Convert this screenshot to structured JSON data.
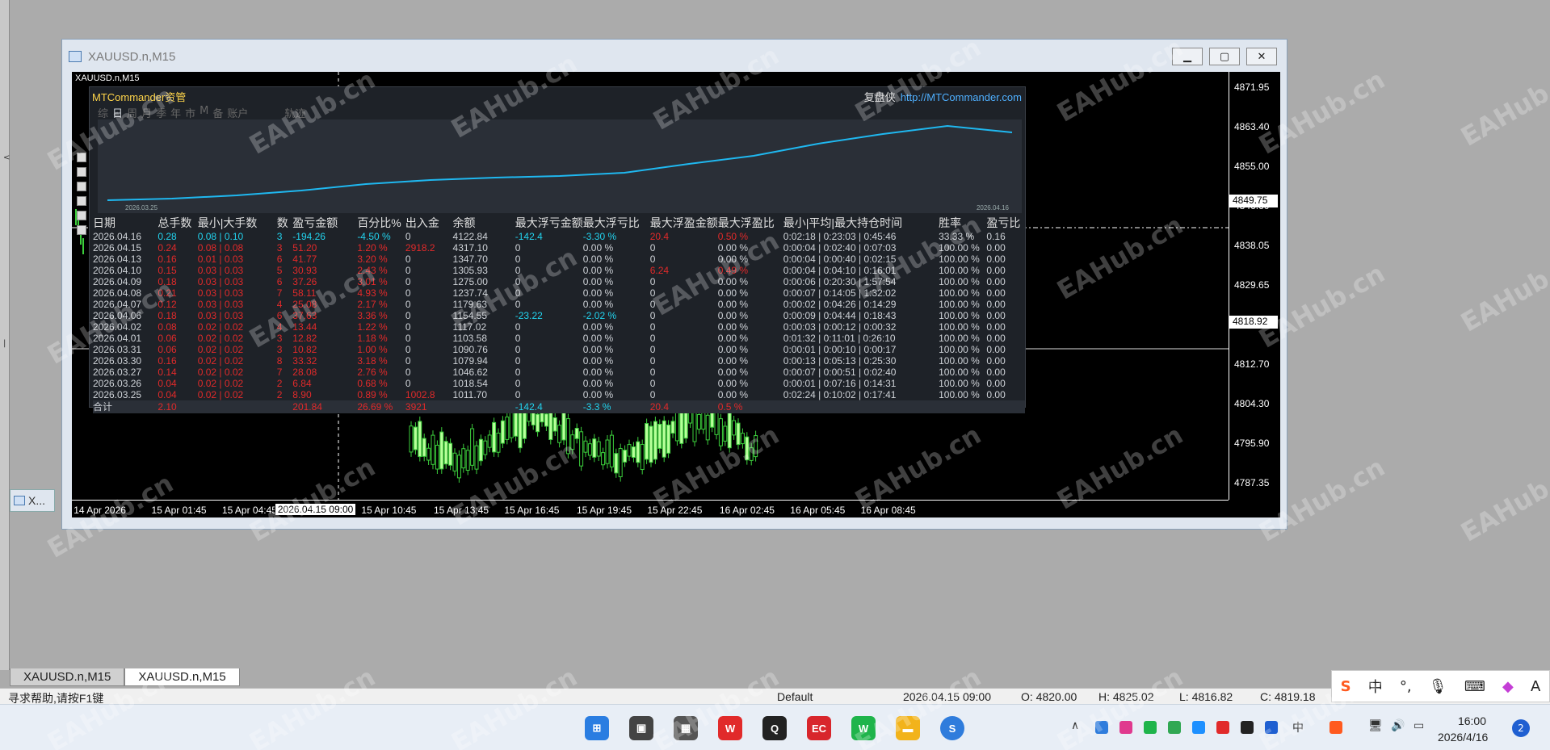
{
  "window": {
    "title": "XAUUSD.n,M15",
    "minimized_label": "X..."
  },
  "chart": {
    "symbol_label": "XAUUSD.n,M15",
    "price_labels": [
      "4871.95",
      "4863.40",
      "4855.00",
      "4846.60",
      "4838.05",
      "4829.65",
      "4821.25",
      "4812.70",
      "4804.30",
      "4795.90",
      "4787.35"
    ],
    "price_tag_1": "4849.75",
    "price_tag_2": "4818.92",
    "time_labels": [
      "14 Apr 2026",
      "15 Apr 01:45",
      "15 Apr 04:45",
      "2026.04.15 09:00",
      "15 Apr 10:45",
      "15 Apr 13:45",
      "15 Apr 16:45",
      "15 Apr 19:45",
      "15 Apr 22:45",
      "16 Apr 02:45",
      "16 Apr 05:45",
      "16 Apr 08:45"
    ],
    "highlighted_time": "2026.04.15 09:00",
    "grid": false
  },
  "overlay": {
    "title": "MTCommander资管",
    "link_prefix": "复盘侠",
    "link": "http://MTCommander.com",
    "tabs": [
      "综",
      "日",
      "周",
      "月",
      "季",
      "年",
      "市",
      "M",
      "备",
      "账户"
    ],
    "active_tab": "日",
    "track_label": "轨迹",
    "equity_start_date": "2026.03.25",
    "equity_end_date": "2026.04.16",
    "headers": [
      "日期",
      "总手数",
      "最小|大手数",
      "数",
      "盈亏金额",
      "百分比%",
      "出入金",
      "余额",
      "最大浮亏金额",
      "最大浮亏比",
      "最大浮盈金额",
      "最大浮盈比",
      "最小|平均|最大持仓时间",
      "胜率",
      "盈亏比"
    ],
    "rows": [
      [
        "2026.04.16",
        "0.28",
        "0.08 | 0.10",
        "3",
        "-194.26",
        "-4.50 %",
        "0",
        "4122.84",
        "-142.4",
        "-3.30 %",
        "20.4",
        "0.50 %",
        "0:02:18 | 0:23:03 | 0:45:46",
        "33.33 %",
        "0.16"
      ],
      [
        "2026.04.15",
        "0.24",
        "0.08 | 0.08",
        "3",
        "51.20",
        "1.20 %",
        "2918.2",
        "4317.10",
        "0",
        "0.00 %",
        "0",
        "0.00 %",
        "0:00:04 | 0:02:40 | 0:07:03",
        "100.00 %",
        "0.00"
      ],
      [
        "2026.04.13",
        "0.16",
        "0.01 | 0.03",
        "6",
        "41.77",
        "3.20 %",
        "0",
        "1347.70",
        "0",
        "0.00 %",
        "0",
        "0.00 %",
        "0:00:04 | 0:00:40 | 0:02:15",
        "100.00 %",
        "0.00"
      ],
      [
        "2026.04.10",
        "0.15",
        "0.03 | 0.03",
        "5",
        "30.93",
        "2.43 %",
        "0",
        "1305.93",
        "0",
        "0.00 %",
        "6.24",
        "0.49 %",
        "0:00:04 | 0:04:10 | 0:16:01",
        "100.00 %",
        "0.00"
      ],
      [
        "2026.04.09",
        "0.18",
        "0.03 | 0.03",
        "6",
        "37.26",
        "3.01 %",
        "0",
        "1275.00",
        "0",
        "0.00 %",
        "0",
        "0.00 %",
        "0:00:06 | 0:20:30 | 1:57:54",
        "100.00 %",
        "0.00"
      ],
      [
        "2026.04.08",
        "0.21",
        "0.03 | 0.03",
        "7",
        "58.11",
        "4.93 %",
        "0",
        "1237.74",
        "0",
        "0.00 %",
        "0",
        "0.00 %",
        "0:00:07 | 0:14:05 | 1:32:02",
        "100.00 %",
        "0.00"
      ],
      [
        "2026.04.07",
        "0.12",
        "0.03 | 0.03",
        "4",
        "25.08",
        "2.17 %",
        "0",
        "1179.63",
        "0",
        "0.00 %",
        "0",
        "0.00 %",
        "0:00:02 | 0:04:26 | 0:14:29",
        "100.00 %",
        "0.00"
      ],
      [
        "2026.04.06",
        "0.18",
        "0.03 | 0.03",
        "6",
        "37.63",
        "3.36 %",
        "0",
        "1154.55",
        "-23.22",
        "-2.02 %",
        "0",
        "0.00 %",
        "0:00:09 | 0:04:44 | 0:18:43",
        "100.00 %",
        "0.00"
      ],
      [
        "2026.04.02",
        "0.08",
        "0.02 | 0.02",
        "4",
        "13.44",
        "1.22 %",
        "0",
        "1117.02",
        "0",
        "0.00 %",
        "0",
        "0.00 %",
        "0:00:03 | 0:00:12 | 0:00:32",
        "100.00 %",
        "0.00"
      ],
      [
        "2026.04.01",
        "0.06",
        "0.02 | 0.02",
        "3",
        "12.82",
        "1.18 %",
        "0",
        "1103.58",
        "0",
        "0.00 %",
        "0",
        "0.00 %",
        "0:01:32 | 0:11:01 | 0:26:10",
        "100.00 %",
        "0.00"
      ],
      [
        "2026.03.31",
        "0.06",
        "0.02 | 0.02",
        "3",
        "10.82",
        "1.00 %",
        "0",
        "1090.76",
        "0",
        "0.00 %",
        "0",
        "0.00 %",
        "0:00:01 | 0:00:10 | 0:00:17",
        "100.00 %",
        "0.00"
      ],
      [
        "2026.03.30",
        "0.16",
        "0.02 | 0.02",
        "8",
        "33.32",
        "3.18 %",
        "0",
        "1079.94",
        "0",
        "0.00 %",
        "0",
        "0.00 %",
        "0:00:13 | 0:05:13 | 0:25:30",
        "100.00 %",
        "0.00"
      ],
      [
        "2026.03.27",
        "0.14",
        "0.02 | 0.02",
        "7",
        "28.08",
        "2.76 %",
        "0",
        "1046.62",
        "0",
        "0.00 %",
        "0",
        "0.00 %",
        "0:00:07 | 0:00:51 | 0:02:40",
        "100.00 %",
        "0.00"
      ],
      [
        "2026.03.26",
        "0.04",
        "0.02 | 0.02",
        "2",
        "6.84",
        "0.68 %",
        "0",
        "1018.54",
        "0",
        "0.00 %",
        "0",
        "0.00 %",
        "0:00:01 | 0:07:16 | 0:14:31",
        "100.00 %",
        "0.00"
      ],
      [
        "2026.03.25",
        "0.04",
        "0.02 | 0.02",
        "2",
        "8.90",
        "0.89 %",
        "1002.8",
        "1011.70",
        "0",
        "0.00 %",
        "0",
        "0.00 %",
        "0:02:24 | 0:10:02 | 0:17:41",
        "100.00 %",
        "0.00"
      ]
    ],
    "total": [
      "合计",
      "2.10",
      "",
      "",
      "201.84",
      "26.69 %",
      "3921",
      "",
      "-142.4",
      "-3.3 %",
      "20.4",
      "0.5 %",
      "",
      "",
      ""
    ],
    "equity_curve": {
      "x": [
        "2026.03.25",
        "2026.03.26",
        "2026.03.27",
        "2026.03.30",
        "2026.03.31",
        "2026.04.01",
        "2026.04.02",
        "2026.04.06",
        "2026.04.07",
        "2026.04.08",
        "2026.04.09",
        "2026.04.10",
        "2026.04.13",
        "2026.04.15",
        "2026.04.16"
      ],
      "y": [
        1011.7,
        1018.54,
        1046.62,
        1079.94,
        1090.76,
        1103.58,
        1117.02,
        1154.55,
        1179.63,
        1237.74,
        1275.0,
        1305.93,
        1347.7,
        4317.1,
        4122.84
      ],
      "color": "#1fb8f0"
    },
    "colors": {
      "positive": "#22d3ee",
      "negative": "#e12a2a",
      "text": "#cfd3d8",
      "bg": "#1e2228"
    }
  },
  "mdi_tabs": [
    "XAUUSD.n,M15",
    "XAUUSD.n,M15"
  ],
  "statusbar": {
    "help": "寻求帮助,请按F1键",
    "profile": "Default",
    "datetime": "2026.04.15 09:00",
    "open": "O: 4820.00",
    "high": "H: 4825.02",
    "low": "L: 4816.82",
    "close": "C: 4819.18"
  },
  "ime": {
    "lang": "中"
  },
  "taskbar": {
    "time": "16:00",
    "date": "2026/4/16",
    "notifications": "2",
    "tray_lang": "中"
  },
  "watermark": "EAHub.cn"
}
